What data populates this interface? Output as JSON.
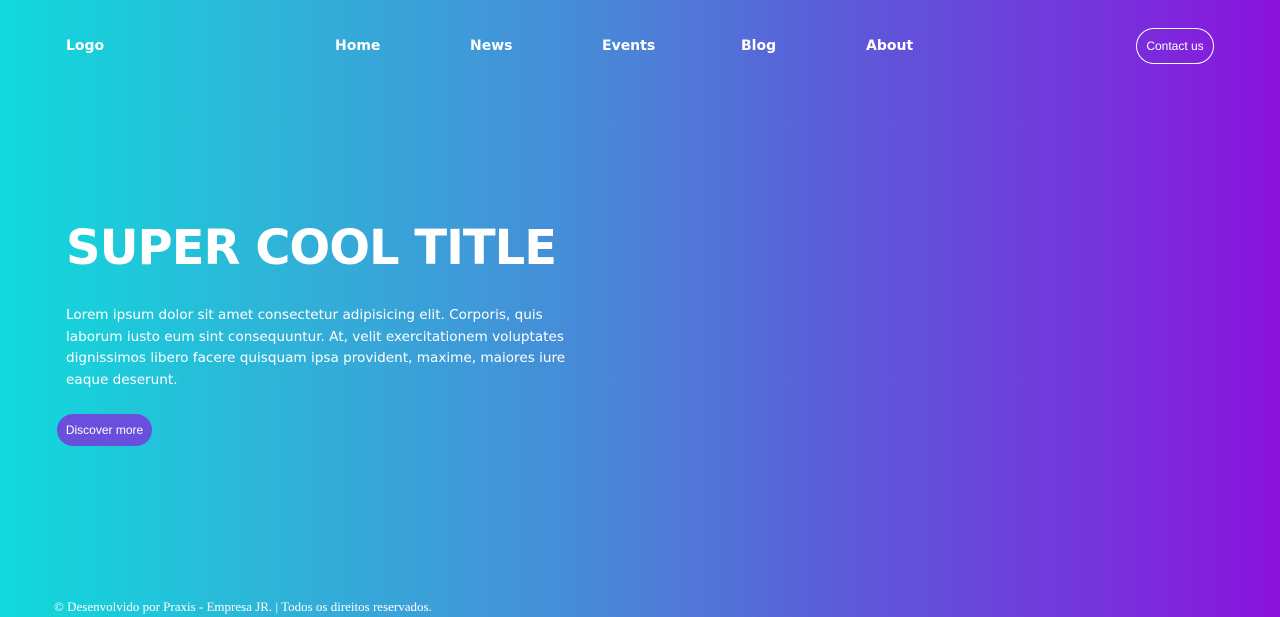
{
  "header": {
    "logo": "Logo",
    "nav": [
      "Home",
      "News",
      "Events",
      "Blog",
      "About"
    ],
    "contact_label": "Contact us"
  },
  "hero": {
    "title": "SUPER COOL TITLE",
    "text": "Lorem ipsum dolor sit amet consectetur adipisicing elit. Corporis, quis laborum iusto eum sint consequuntur. At, velit exercitationem voluptates dignissimos libero facere quisquam ipsa provident, maxime, maiores iure eaque deserunt.",
    "button_label": "Discover more"
  },
  "footer": {
    "text": "© Desenvolvido por Praxis - Empresa JR. | Todos os direitos reservados."
  },
  "colors": {
    "gradient_start": "#10dadc",
    "gradient_end": "#8b12dd",
    "button_bg": "#6a4fdc",
    "text": "#ffffff"
  }
}
